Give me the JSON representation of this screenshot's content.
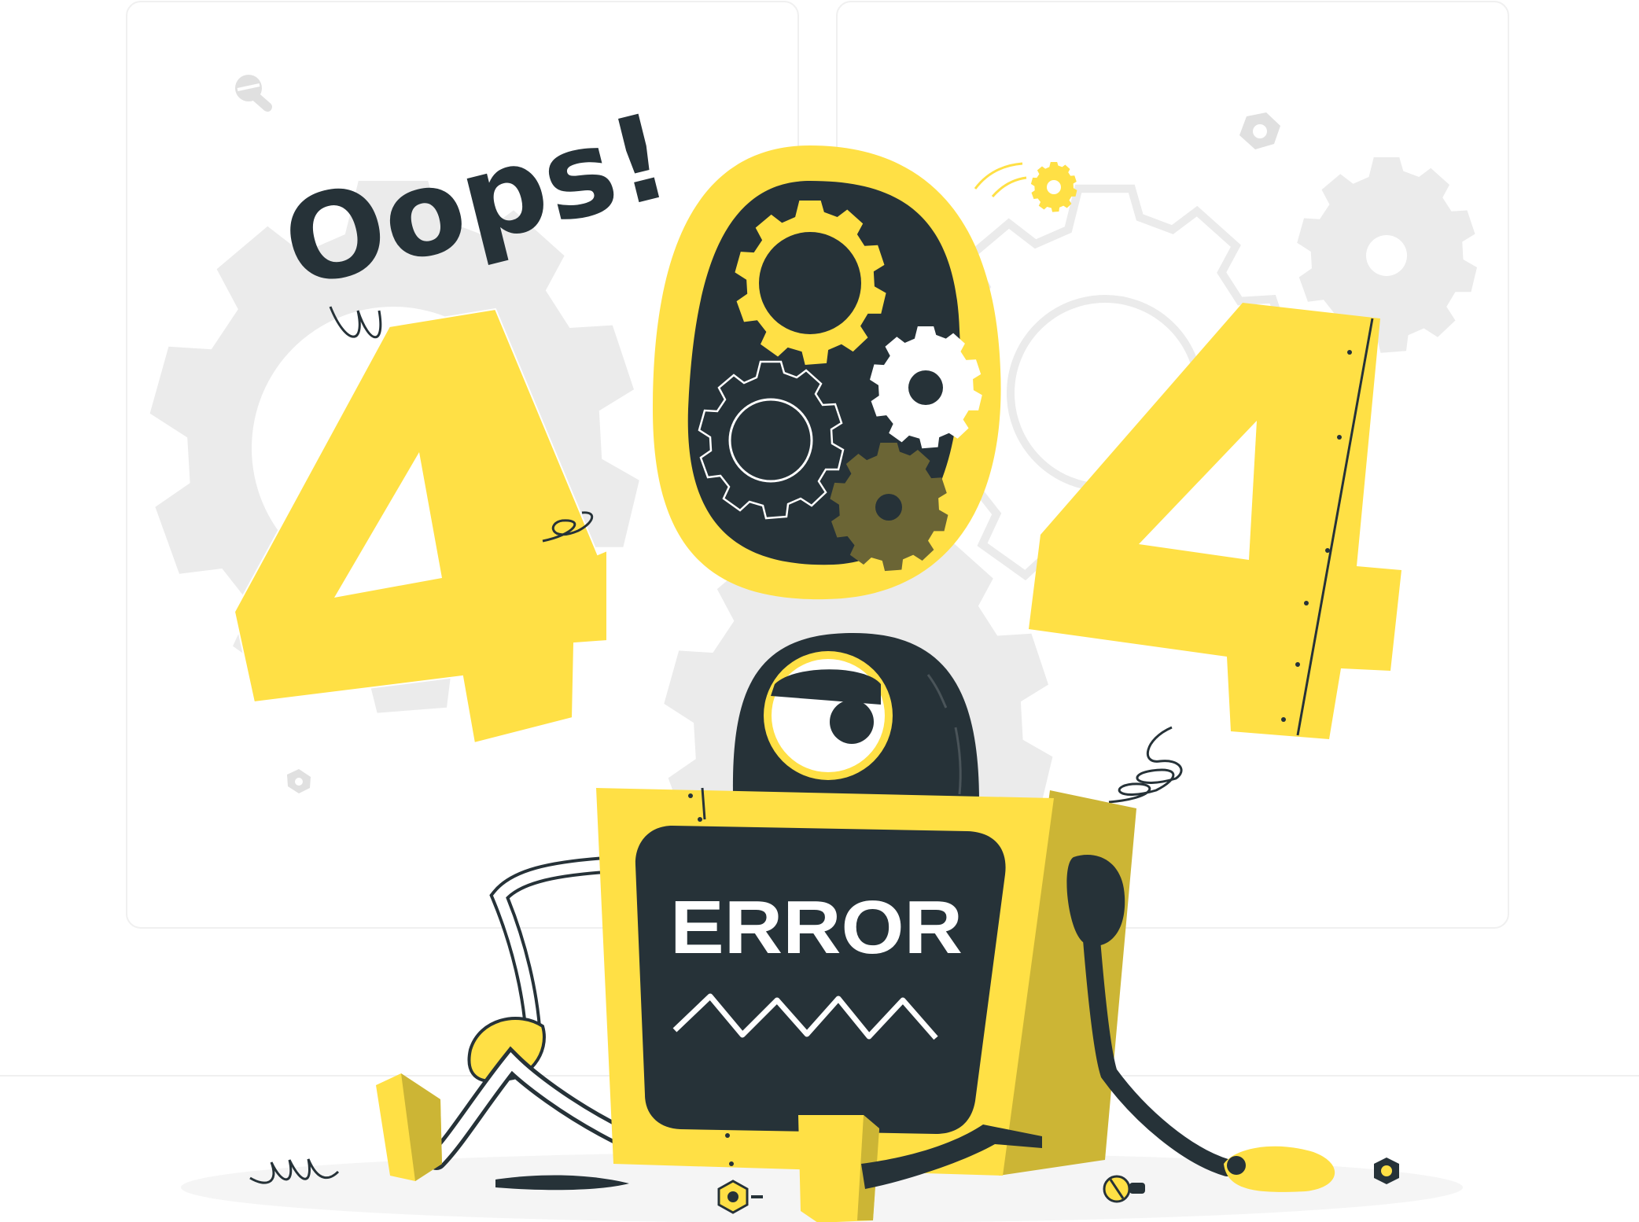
{
  "illustration": {
    "headline": "Oops!",
    "digit_left": "4",
    "digit_right": "4",
    "screen_label": "ERROR"
  },
  "colors": {
    "accent_yellow": "#FFE045",
    "dark_yellow": "#CCB535",
    "dark": "#263238",
    "gear_gray": "#EBEBEB",
    "panel_border": "#EBEBEB",
    "olive_gear": "#6B6535"
  },
  "icons": {
    "gear": "gear-icon",
    "nut": "hex-nut-icon",
    "screw": "screw-icon",
    "spring": "spring-icon"
  }
}
